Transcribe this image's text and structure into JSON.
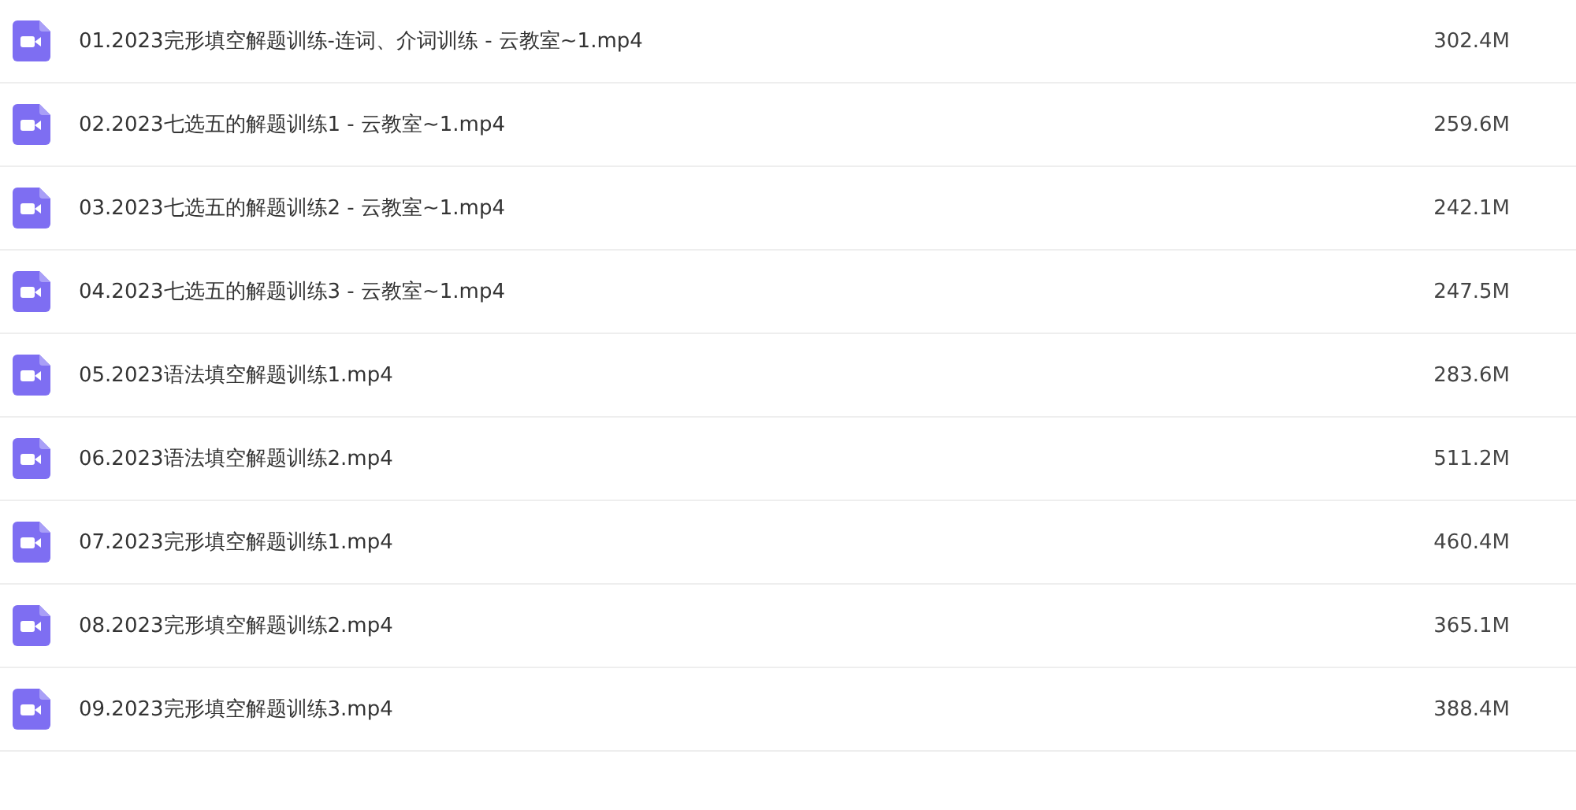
{
  "files": [
    {
      "name": "01.2023完形填空解题训练-连词、介词训练 - 云教室~1.mp4",
      "size": "302.4M"
    },
    {
      "name": "02.2023七选五的解题训练1 - 云教室~1.mp4",
      "size": "259.6M"
    },
    {
      "name": "03.2023七选五的解题训练2 - 云教室~1.mp4",
      "size": "242.1M"
    },
    {
      "name": "04.2023七选五的解题训练3 - 云教室~1.mp4",
      "size": "247.5M"
    },
    {
      "name": "05.2023语法填空解题训练1.mp4",
      "size": "283.6M"
    },
    {
      "name": "06.2023语法填空解题训练2.mp4",
      "size": "511.2M"
    },
    {
      "name": "07.2023完形填空解题训练1.mp4",
      "size": "460.4M"
    },
    {
      "name": "08.2023完形填空解题训练2.mp4",
      "size": "365.1M"
    },
    {
      "name": "09.2023完形填空解题训练3.mp4",
      "size": "388.4M"
    }
  ]
}
